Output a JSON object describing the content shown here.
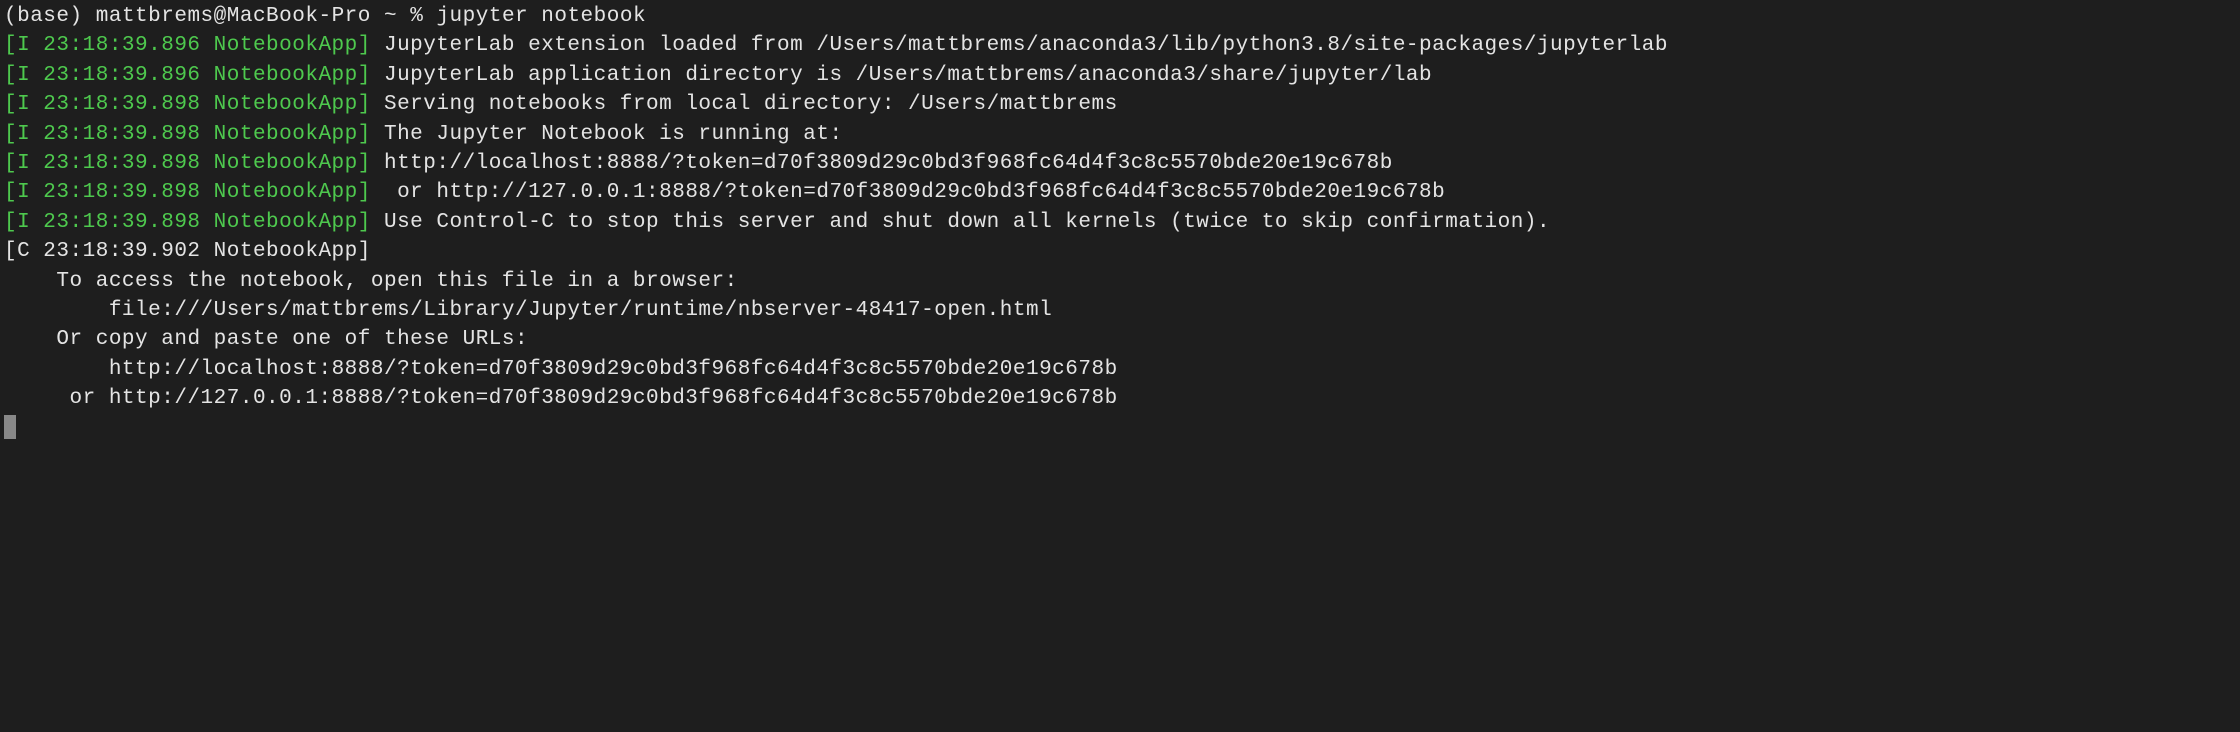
{
  "prompt": {
    "env": "(base)",
    "user_host": "mattbrems@MacBook-Pro",
    "path": "~",
    "symbol": "%",
    "command": "jupyter notebook"
  },
  "logs": [
    {
      "prefix": "[I 23:18:39.896 NotebookApp]",
      "message": "JupyterLab extension loaded from /Users/mattbrems/anaconda3/lib/python3.8/site-packages/jupyterlab",
      "prefix_color": "green"
    },
    {
      "prefix": "[I 23:18:39.896 NotebookApp]",
      "message": "JupyterLab application directory is /Users/mattbrems/anaconda3/share/jupyter/lab",
      "prefix_color": "green"
    },
    {
      "prefix": "[I 23:18:39.898 NotebookApp]",
      "message": "Serving notebooks from local directory: /Users/mattbrems",
      "prefix_color": "green"
    },
    {
      "prefix": "[I 23:18:39.898 NotebookApp]",
      "message": "The Jupyter Notebook is running at:",
      "prefix_color": "green"
    },
    {
      "prefix": "[I 23:18:39.898 NotebookApp]",
      "message": "http://localhost:8888/?token=d70f3809d29c0bd3f968fc64d4f3c8c5570bde20e19c678b",
      "prefix_color": "green"
    },
    {
      "prefix": "[I 23:18:39.898 NotebookApp]",
      "message": " or http://127.0.0.1:8888/?token=d70f3809d29c0bd3f968fc64d4f3c8c5570bde20e19c678b",
      "prefix_color": "green"
    },
    {
      "prefix": "[I 23:18:39.898 NotebookApp]",
      "message": "Use Control-C to stop this server and shut down all kernels (twice to skip confirmation).",
      "prefix_color": "green"
    },
    {
      "prefix": "[C 23:18:39.902 NotebookApp]",
      "message": "",
      "prefix_color": "white"
    }
  ],
  "footer": {
    "blank": "",
    "line1": "    To access the notebook, open this file in a browser:",
    "line2": "        file:///Users/mattbrems/Library/Jupyter/runtime/nbserver-48417-open.html",
    "line3": "    Or copy and paste one of these URLs:",
    "line4": "        http://localhost:8888/?token=d70f3809d29c0bd3f968fc64d4f3c8c5570bde20e19c678b",
    "line5": "     or http://127.0.0.1:8888/?token=d70f3809d29c0bd3f968fc64d4f3c8c5570bde20e19c678b"
  }
}
